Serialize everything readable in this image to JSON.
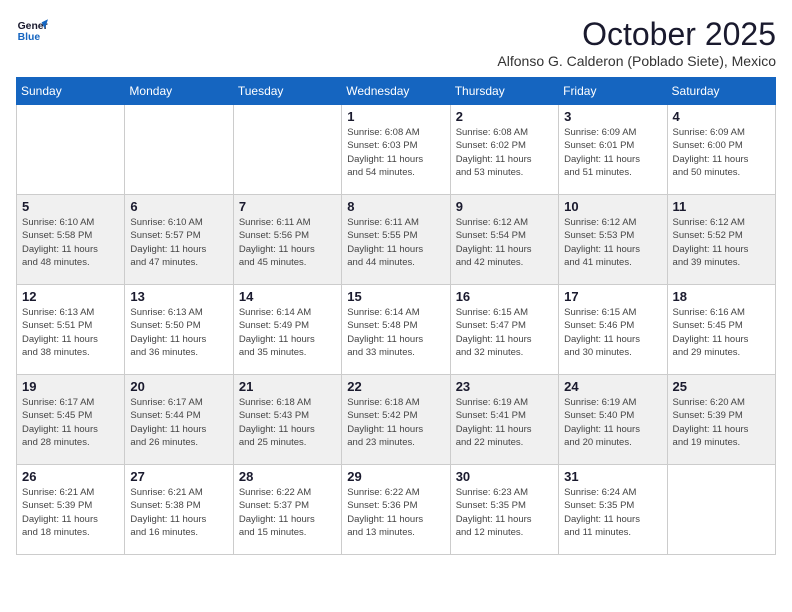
{
  "logo": {
    "line1": "General",
    "line2": "Blue"
  },
  "title": "October 2025",
  "subtitle": "Alfonso G. Calderon (Poblado Siete), Mexico",
  "days_of_week": [
    "Sunday",
    "Monday",
    "Tuesday",
    "Wednesday",
    "Thursday",
    "Friday",
    "Saturday"
  ],
  "weeks": [
    [
      {
        "day": "",
        "info": ""
      },
      {
        "day": "",
        "info": ""
      },
      {
        "day": "",
        "info": ""
      },
      {
        "day": "1",
        "info": "Sunrise: 6:08 AM\nSunset: 6:03 PM\nDaylight: 11 hours\nand 54 minutes."
      },
      {
        "day": "2",
        "info": "Sunrise: 6:08 AM\nSunset: 6:02 PM\nDaylight: 11 hours\nand 53 minutes."
      },
      {
        "day": "3",
        "info": "Sunrise: 6:09 AM\nSunset: 6:01 PM\nDaylight: 11 hours\nand 51 minutes."
      },
      {
        "day": "4",
        "info": "Sunrise: 6:09 AM\nSunset: 6:00 PM\nDaylight: 11 hours\nand 50 minutes."
      }
    ],
    [
      {
        "day": "5",
        "info": "Sunrise: 6:10 AM\nSunset: 5:58 PM\nDaylight: 11 hours\nand 48 minutes."
      },
      {
        "day": "6",
        "info": "Sunrise: 6:10 AM\nSunset: 5:57 PM\nDaylight: 11 hours\nand 47 minutes."
      },
      {
        "day": "7",
        "info": "Sunrise: 6:11 AM\nSunset: 5:56 PM\nDaylight: 11 hours\nand 45 minutes."
      },
      {
        "day": "8",
        "info": "Sunrise: 6:11 AM\nSunset: 5:55 PM\nDaylight: 11 hours\nand 44 minutes."
      },
      {
        "day": "9",
        "info": "Sunrise: 6:12 AM\nSunset: 5:54 PM\nDaylight: 11 hours\nand 42 minutes."
      },
      {
        "day": "10",
        "info": "Sunrise: 6:12 AM\nSunset: 5:53 PM\nDaylight: 11 hours\nand 41 minutes."
      },
      {
        "day": "11",
        "info": "Sunrise: 6:12 AM\nSunset: 5:52 PM\nDaylight: 11 hours\nand 39 minutes."
      }
    ],
    [
      {
        "day": "12",
        "info": "Sunrise: 6:13 AM\nSunset: 5:51 PM\nDaylight: 11 hours\nand 38 minutes."
      },
      {
        "day": "13",
        "info": "Sunrise: 6:13 AM\nSunset: 5:50 PM\nDaylight: 11 hours\nand 36 minutes."
      },
      {
        "day": "14",
        "info": "Sunrise: 6:14 AM\nSunset: 5:49 PM\nDaylight: 11 hours\nand 35 minutes."
      },
      {
        "day": "15",
        "info": "Sunrise: 6:14 AM\nSunset: 5:48 PM\nDaylight: 11 hours\nand 33 minutes."
      },
      {
        "day": "16",
        "info": "Sunrise: 6:15 AM\nSunset: 5:47 PM\nDaylight: 11 hours\nand 32 minutes."
      },
      {
        "day": "17",
        "info": "Sunrise: 6:15 AM\nSunset: 5:46 PM\nDaylight: 11 hours\nand 30 minutes."
      },
      {
        "day": "18",
        "info": "Sunrise: 6:16 AM\nSunset: 5:45 PM\nDaylight: 11 hours\nand 29 minutes."
      }
    ],
    [
      {
        "day": "19",
        "info": "Sunrise: 6:17 AM\nSunset: 5:45 PM\nDaylight: 11 hours\nand 28 minutes."
      },
      {
        "day": "20",
        "info": "Sunrise: 6:17 AM\nSunset: 5:44 PM\nDaylight: 11 hours\nand 26 minutes."
      },
      {
        "day": "21",
        "info": "Sunrise: 6:18 AM\nSunset: 5:43 PM\nDaylight: 11 hours\nand 25 minutes."
      },
      {
        "day": "22",
        "info": "Sunrise: 6:18 AM\nSunset: 5:42 PM\nDaylight: 11 hours\nand 23 minutes."
      },
      {
        "day": "23",
        "info": "Sunrise: 6:19 AM\nSunset: 5:41 PM\nDaylight: 11 hours\nand 22 minutes."
      },
      {
        "day": "24",
        "info": "Sunrise: 6:19 AM\nSunset: 5:40 PM\nDaylight: 11 hours\nand 20 minutes."
      },
      {
        "day": "25",
        "info": "Sunrise: 6:20 AM\nSunset: 5:39 PM\nDaylight: 11 hours\nand 19 minutes."
      }
    ],
    [
      {
        "day": "26",
        "info": "Sunrise: 6:21 AM\nSunset: 5:39 PM\nDaylight: 11 hours\nand 18 minutes."
      },
      {
        "day": "27",
        "info": "Sunrise: 6:21 AM\nSunset: 5:38 PM\nDaylight: 11 hours\nand 16 minutes."
      },
      {
        "day": "28",
        "info": "Sunrise: 6:22 AM\nSunset: 5:37 PM\nDaylight: 11 hours\nand 15 minutes."
      },
      {
        "day": "29",
        "info": "Sunrise: 6:22 AM\nSunset: 5:36 PM\nDaylight: 11 hours\nand 13 minutes."
      },
      {
        "day": "30",
        "info": "Sunrise: 6:23 AM\nSunset: 5:35 PM\nDaylight: 11 hours\nand 12 minutes."
      },
      {
        "day": "31",
        "info": "Sunrise: 6:24 AM\nSunset: 5:35 PM\nDaylight: 11 hours\nand 11 minutes."
      },
      {
        "day": "",
        "info": ""
      }
    ]
  ]
}
